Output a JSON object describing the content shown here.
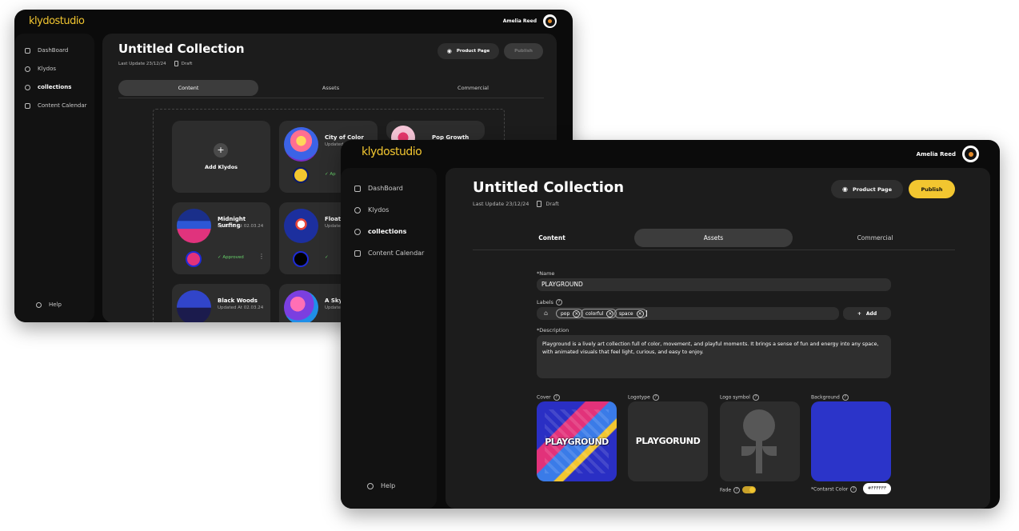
{
  "app": {
    "brand": "klydostudio",
    "user_name": "Amelia Reed"
  },
  "sidebar": {
    "items": [
      {
        "label": "DashBoard",
        "icon": "home-icon"
      },
      {
        "label": "Klydos",
        "icon": "clock-icon"
      },
      {
        "label": "collections",
        "icon": "collections-icon",
        "active": true
      },
      {
        "label": "Content Calendar",
        "icon": "calendar-icon"
      }
    ],
    "help_label": "Help"
  },
  "back_window": {
    "title": "Untitled Collection",
    "last_update": "Last Update 23/12/24",
    "status": "Draft",
    "buttons": {
      "product_page": "Product Page",
      "publish": "Publish"
    },
    "tabs": [
      "Content",
      "Assets",
      "Commercial"
    ],
    "active_tab": "Content",
    "add_label": "Add Klydos",
    "cards": [
      {
        "title": "City of Color",
        "subtitle": "Updated",
        "badge": "Ap",
        "dial_color": "#f2c630"
      },
      {
        "title": "Pop Growth",
        "subtitle": "",
        "badge": "",
        "dial_color": ""
      },
      {
        "title": "Midnight Surfing",
        "subtitle": "Updated At 02.03.24",
        "badge": "Approved",
        "dial_color": "#e2327a"
      },
      {
        "title": "Floati",
        "subtitle": "Updated",
        "badge": "",
        "dial_color": "#1e2bd6"
      },
      {
        "title": "Black Woods",
        "subtitle": "Updated At 02.03.24",
        "badge": "",
        "dial_color": ""
      },
      {
        "title": "A Sky",
        "subtitle": "Updated",
        "badge": "",
        "dial_color": ""
      }
    ]
  },
  "front_window": {
    "title": "Untitled Collection",
    "last_update": "Last Update 23/12/24",
    "status": "Draft",
    "buttons": {
      "product_page": "Product Page",
      "publish": "Publish"
    },
    "tabs": [
      "Content",
      "Assets",
      "Commercial"
    ],
    "active_tab": "Assets",
    "form": {
      "name_label": "*Name",
      "name_value": "PLAYGROUND",
      "labels_label": "Labels",
      "labels": [
        "pop",
        "colorful",
        "space"
      ],
      "add_label": "Add",
      "description_label": "*Description",
      "description_value": "Playground is a lively art collection full of color, movement, and playful moments. It brings a sense of fun and energy into any space, with animated visuals that feel light, curious, and easy to enjoy.",
      "cover_label": "Cover",
      "cover_text": "PLAYGROUND",
      "logotype_label": "Logotype",
      "logotype_text": "PLAYGORUND",
      "logo_symbol_label": "Logo symbol",
      "background_label": "Background",
      "fade_label": "Fade",
      "contrast_label": "*Contarst Color",
      "contrast_value": "#FFFFFF"
    }
  },
  "colors": {
    "accent": "#f2c630",
    "background": "#0b0b0b",
    "panel": "#1c1c1c",
    "approved": "#67d06a",
    "cover_bg": "#2a2fc4",
    "background_swatch": "#2b34c9"
  }
}
